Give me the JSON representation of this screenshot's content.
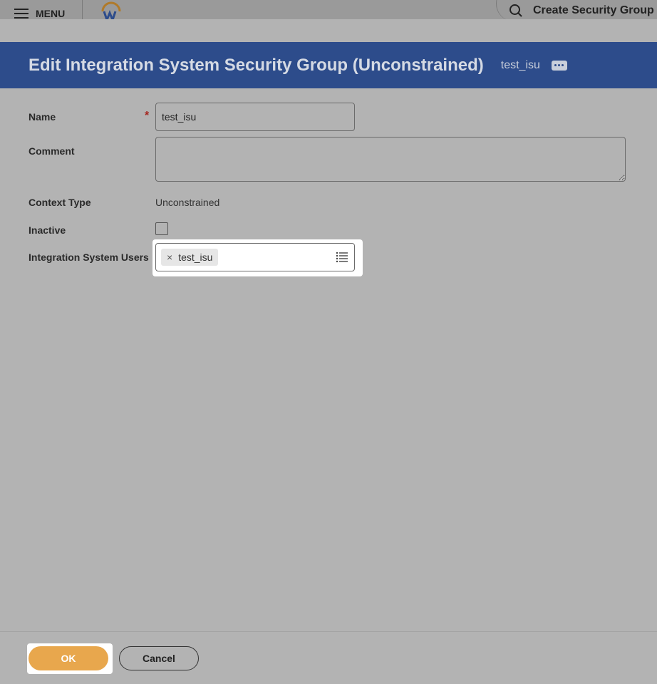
{
  "topbar": {
    "menu_label": "MENU",
    "search_label": "Create Security Group"
  },
  "dialog": {
    "title": "Edit Integration System Security Group (Unconstrained)",
    "subtitle": "test_isu"
  },
  "form": {
    "name": {
      "label": "Name",
      "value": "test_isu",
      "required_mark": "*"
    },
    "comment": {
      "label": "Comment",
      "value": ""
    },
    "context_type": {
      "label": "Context Type",
      "value": "Unconstrained"
    },
    "inactive": {
      "label": "Inactive",
      "checked": false
    },
    "integration_system_users": {
      "label": "Integration System Users",
      "selected": [
        "test_isu"
      ],
      "remove_glyph": "×"
    }
  },
  "footer": {
    "ok_label": "OK",
    "cancel_label": "Cancel"
  },
  "colors": {
    "header_bg": "#2d4c8b",
    "ok_button": "#e8a74d",
    "required": "#a5231c"
  }
}
